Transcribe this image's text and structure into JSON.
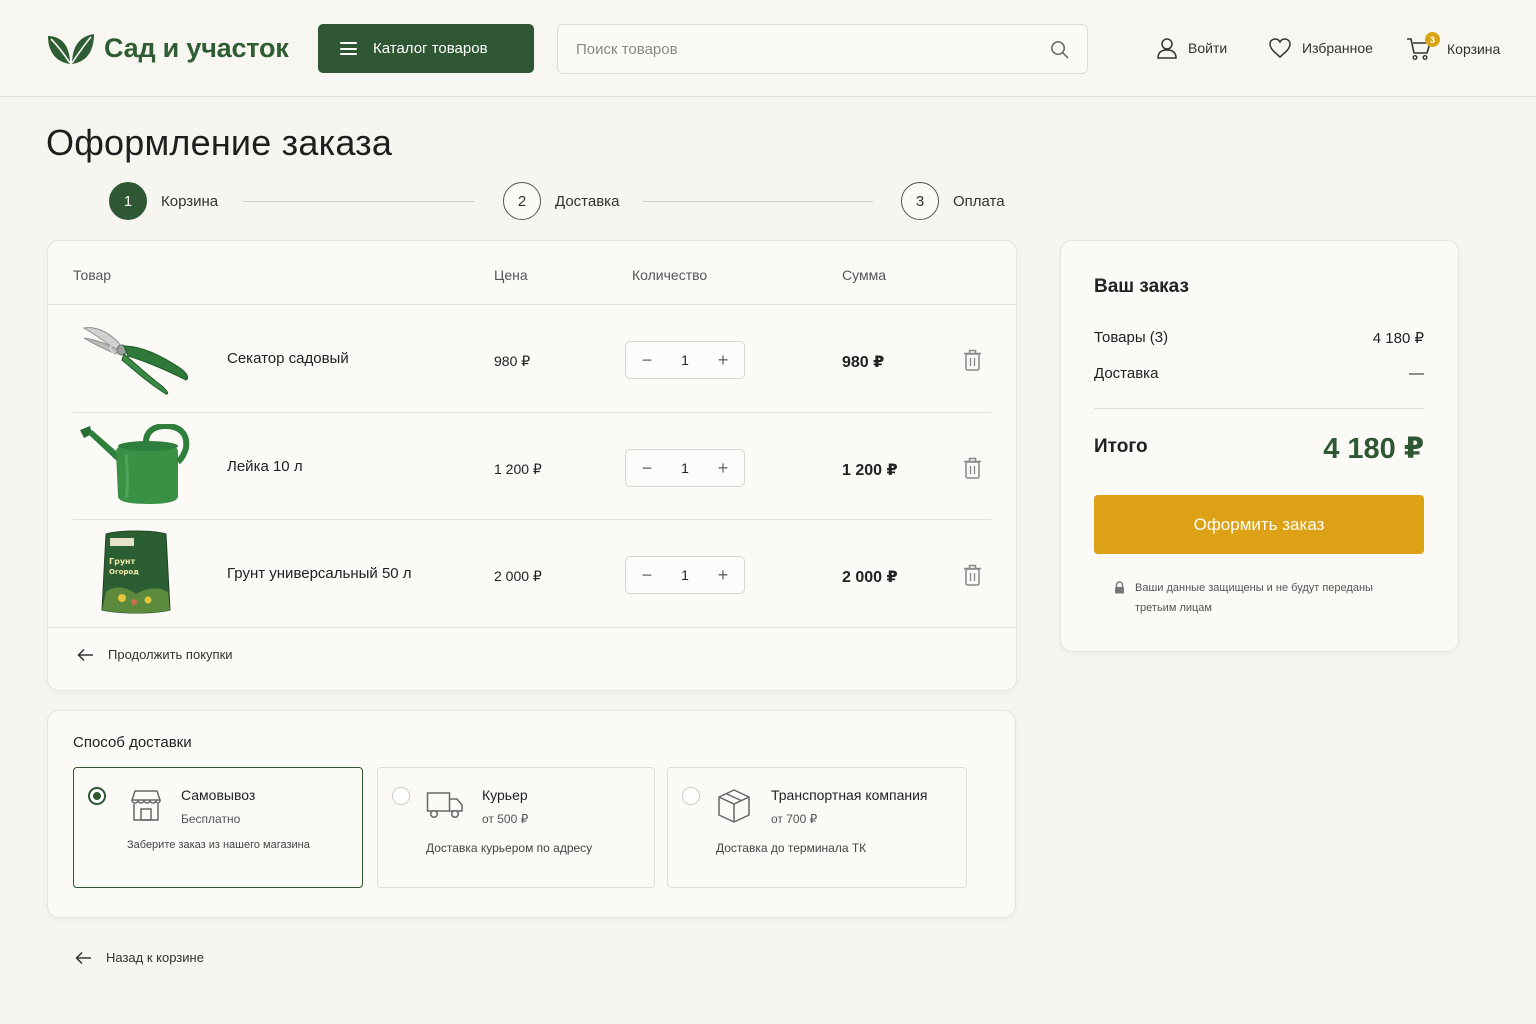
{
  "header": {
    "logo_text": "Сад и участок",
    "catalog_label": "Каталог товаров",
    "search_placeholder": "Поиск товаров",
    "login_label": "Войти",
    "favorites_label": "Избранное",
    "cart_label": "Корзина",
    "cart_count": "3"
  },
  "page": {
    "title": "Оформление заказа"
  },
  "steps": [
    {
      "num": "1",
      "label": "Корзина",
      "active": true
    },
    {
      "num": "2",
      "label": "Доставка",
      "active": false
    },
    {
      "num": "3",
      "label": "Оплата",
      "active": false
    }
  ],
  "cart": {
    "columns": {
      "product": "Товар",
      "price": "Цена",
      "quantity": "Количество",
      "sum": "Сумма"
    },
    "items": [
      {
        "name": "Секатор садовый",
        "price": "980 ₽",
        "qty": "1",
        "sum": "980 ₽",
        "image": "pruner-image"
      },
      {
        "name": "Лейка 10 л",
        "price": "1 200 ₽",
        "qty": "1",
        "sum": "1 200 ₽",
        "image": "watering-can-image"
      },
      {
        "name": "Грунт универсальный 50 л",
        "price": "2 000 ₽",
        "qty": "1",
        "sum": "2 000 ₽",
        "image": "soil-bag-image",
        "bag_text_1": "Грунт",
        "bag_text_2": "Огород"
      }
    ],
    "continue_label": "Продолжить покупки"
  },
  "delivery": {
    "title": "Способ доставки",
    "options": [
      {
        "name": "Самовывоз",
        "price": "Бесплатно",
        "desc": "Заберите заказ из нашего магазина",
        "selected": true,
        "icon": "store-icon"
      },
      {
        "name": "Курьер",
        "price": "от 500 ₽",
        "desc": "Доставка курьером по адресу",
        "selected": false,
        "icon": "truck-icon"
      },
      {
        "name": "Транспортная компания",
        "price": "от 700 ₽",
        "desc": "Доставка до терминала ТК",
        "selected": false,
        "icon": "box-icon"
      }
    ]
  },
  "back_label": "Назад к корзине",
  "summary": {
    "title": "Ваш заказ",
    "items_label": "Товары (3)",
    "items_value": "4 180 ₽",
    "delivery_label": "Доставка",
    "delivery_value": "—",
    "total_label": "Итого",
    "total_value": "4 180 ₽",
    "checkout_label": "Оформить заказ",
    "secure_text": "Ваши данные защищены и не будут переданы третьим лицам"
  },
  "colors": {
    "brand_green": "#2f5733",
    "accent_yellow": "#dca114",
    "background": "#f6f5f0"
  }
}
